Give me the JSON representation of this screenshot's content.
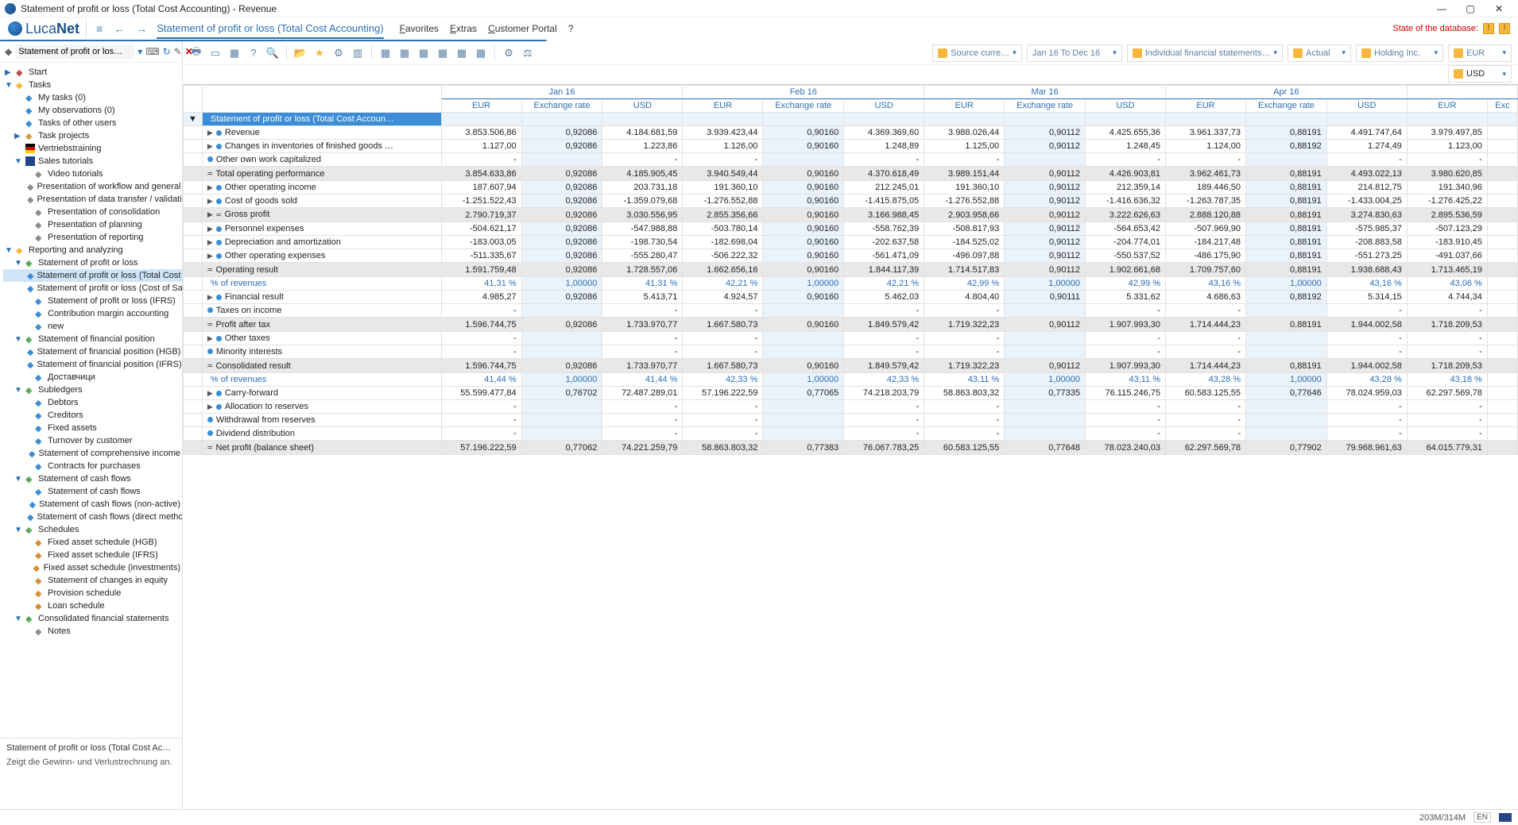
{
  "window": {
    "title": "Statement of profit or loss (Total Cost Accounting) - Revenue"
  },
  "brand": {
    "prefix": "Luca",
    "suffix": "Net"
  },
  "nav": {
    "breadcrumb": "Statement of profit or loss (Total Cost Accounting)"
  },
  "topmenu": {
    "fav": "Favorites",
    "ext": "Extras",
    "portal": "Customer Portal",
    "help": "?"
  },
  "state_db": {
    "label": "State of the database:"
  },
  "sidebar": {
    "search_placeholder": "Statement of profit or los…",
    "start": "Start",
    "tasks_h": "Tasks",
    "my_tasks": "My tasks (0)",
    "my_obs": "My observations (0)",
    "tasks_other": "Tasks of other users",
    "task_proj": "Task projects",
    "vertrieb": "Vertriebstraining",
    "sales": "Sales tutorials",
    "video": "Video tutorials",
    "pres_wf": "Presentation of workflow and general h…",
    "pres_dt": "Presentation of data transfer / validatio…",
    "pres_cons": "Presentation of consolidation",
    "pres_plan": "Presentation of planning",
    "pres_rep": "Presentation of reporting",
    "rep_h": "Reporting and analyzing",
    "spl": "Statement of profit or loss",
    "spl_tca": "Statement of profit or loss (Total Cost A…",
    "spl_cos": "Statement of profit or loss (Cost of Sales)",
    "spl_ifrs": "Statement of profit or loss (IFRS)",
    "cma": "Contribution margin accounting",
    "new": "new",
    "sfp": "Statement of financial position",
    "sfp_hgb": "Statement of financial position (HGB)",
    "sfp_ifrs": "Statement of financial position (IFRS)",
    "dost": "Доставчици",
    "subl": "Subledgers",
    "debtors": "Debtors",
    "creditors": "Creditors",
    "fa": "Fixed assets",
    "tbc": "Turnover by customer",
    "sci": "Statement of comprehensive income",
    "cfp": "Contracts for purchases",
    "scf": "Statement of cash flows",
    "scf1": "Statement of cash flows",
    "scf2": "Statement of cash flows (non-active)",
    "scf3": "Statement of cash flows (direct method)",
    "sched": "Schedules",
    "fas_hgb": "Fixed asset schedule (HGB)",
    "fas_ifrs": "Fixed asset schedule (IFRS)",
    "fas_inv": "Fixed asset schedule (investments)",
    "scie": "Statement of changes in equity",
    "prov": "Provision schedule",
    "loan": "Loan schedule",
    "cfs": "Consolidated financial statements",
    "notes": "Notes",
    "foot_title": "Statement of profit or loss (Total Cost Ac…",
    "foot_desc": "Zeigt die Gewinn- und Verlustrechnung an."
  },
  "filters": {
    "source": "Source curre…",
    "period": "Jan 16 To Dec 16",
    "ifs": "Individual financial statements…",
    "actual": "Actual",
    "entity": "Holding Inc.",
    "cur1": "EUR",
    "cur2": "USD"
  },
  "months": [
    "Jan 16",
    "Feb 16",
    "Mar 16",
    "Apr 16",
    ""
  ],
  "subcols": {
    "eur": "EUR",
    "rate": "Exchange rate",
    "usd": "USD",
    "exc": "Exc"
  },
  "rows": [
    {
      "k": "section",
      "lbl": "Statement of profit or loss (Total Cost Accoun…",
      "v": [
        "",
        "",
        "",
        "",
        "",
        "",
        "",
        "",
        "",
        "",
        "",
        "",
        "",
        ""
      ]
    },
    {
      "k": "d",
      "ic": "tb",
      "lbl": "Revenue",
      "v": [
        "3.853.506,86",
        "0,92086",
        "4.184.681,59",
        "3.939.423,44",
        "0,90160",
        "4.369.369,60",
        "3.988.026,44",
        "0,90112",
        "4.425.655,36",
        "3.961.337,73",
        "0,88191",
        "4.491.747,64",
        "3.979.497,85",
        ""
      ]
    },
    {
      "k": "d",
      "ic": "tb",
      "lbl": "Changes in inventories of finished goods …",
      "v": [
        "1.127,00",
        "0,92086",
        "1.223,86",
        "1.126,00",
        "0,90160",
        "1.248,89",
        "1.125,00",
        "0,90112",
        "1.248,45",
        "1.124,00",
        "0,88192",
        "1.274,49",
        "1.123,00",
        ""
      ]
    },
    {
      "k": "d",
      "ic": "b",
      "lbl": "Other own work capitalized",
      "v": [
        "-",
        "",
        "-",
        "-",
        "",
        "-",
        "-",
        "",
        "-",
        "-",
        "",
        "-",
        "-",
        ""
      ]
    },
    {
      "k": "subtotal",
      "ic": "eq",
      "lbl": "Total operating performance",
      "v": [
        "3.854.633,86",
        "0,92086",
        "4.185.905,45",
        "3.940.549,44",
        "0,90160",
        "4.370.618,49",
        "3.989.151,44",
        "0,90112",
        "4.426.903,81",
        "3.962.461,73",
        "0,88191",
        "4.493.022,13",
        "3.980.620,85",
        ""
      ]
    },
    {
      "k": "d",
      "ic": "tb",
      "lbl": "Other operating income",
      "v": [
        "187.607,94",
        "0,92086",
        "203.731,18",
        "191.360,10",
        "0,90160",
        "212.245,01",
        "191.360,10",
        "0,90112",
        "212.359,14",
        "189.446,50",
        "0,88191",
        "214.812,75",
        "191.340,96",
        ""
      ]
    },
    {
      "k": "d",
      "ic": "tb",
      "lbl": "Cost of goods sold",
      "v": [
        "-1.251.522,43",
        "0,92086",
        "-1.359.079,68",
        "-1.276.552,88",
        "0,90160",
        "-1.415.875,05",
        "-1.276.552,88",
        "0,90112",
        "-1.416.636,32",
        "-1.263.787,35",
        "0,88191",
        "-1.433.004,25",
        "-1.276.425,22",
        ""
      ]
    },
    {
      "k": "subtotal",
      "ic": "teq",
      "lbl": "Gross profit",
      "v": [
        "2.790.719,37",
        "0,92086",
        "3.030.556,95",
        "2.855.356,66",
        "0,90160",
        "3.166.988,45",
        "2.903.958,66",
        "0,90112",
        "3.222.626,63",
        "2.888.120,88",
        "0,88191",
        "3.274.830,63",
        "2.895.536,59",
        ""
      ]
    },
    {
      "k": "d",
      "ic": "tb",
      "lbl": "Personnel expenses",
      "v": [
        "-504.621,17",
        "0,92086",
        "-547.988,88",
        "-503.780,14",
        "0,90160",
        "-558.762,39",
        "-508.817,93",
        "0,90112",
        "-564.653,42",
        "-507.969,90",
        "0,88191",
        "-575.985,37",
        "-507.123,29",
        ""
      ]
    },
    {
      "k": "d",
      "ic": "tb",
      "lbl": "Depreciation and amortization",
      "v": [
        "-183.003,05",
        "0,92086",
        "-198.730,54",
        "-182.698,04",
        "0,90160",
        "-202.637,58",
        "-184.525,02",
        "0,90112",
        "-204.774,01",
        "-184.217,48",
        "0,88191",
        "-208.883,58",
        "-183.910,45",
        ""
      ]
    },
    {
      "k": "d",
      "ic": "tb",
      "lbl": "Other operating expenses",
      "v": [
        "-511.335,67",
        "0,92086",
        "-555.280,47",
        "-506.222,32",
        "0,90160",
        "-561.471,09",
        "-496.097,88",
        "0,90112",
        "-550.537,52",
        "-486.175,90",
        "0,88191",
        "-551.273,25",
        "-491.037,66",
        ""
      ]
    },
    {
      "k": "subtotal",
      "ic": "eq",
      "lbl": "Operating result",
      "v": [
        "1.591.759,48",
        "0,92086",
        "1.728.557,06",
        "1.662.656,16",
        "0,90160",
        "1.844.117,39",
        "1.714.517,83",
        "0,90112",
        "1.902.661,68",
        "1.709.757,60",
        "0,88191",
        "1.938.688,43",
        "1.713.465,19",
        ""
      ]
    },
    {
      "k": "pct",
      "lbl": "% of revenues",
      "v": [
        "41,31 %",
        "1,00000",
        "41,31 %",
        "42,21 %",
        "1,00000",
        "42,21 %",
        "42,99 %",
        "1,00000",
        "42,99 %",
        "43,16 %",
        "1,00000",
        "43,16 %",
        "43,06 %",
        ""
      ]
    },
    {
      "k": "d",
      "ic": "tb",
      "lbl": "Financial result",
      "v": [
        "4.985,27",
        "0,92086",
        "5.413,71",
        "4.924,57",
        "0,90160",
        "5.462,03",
        "4.804,40",
        "0,90111",
        "5.331,62",
        "4.686,63",
        "0,88192",
        "5.314,15",
        "4.744,34",
        ""
      ]
    },
    {
      "k": "d",
      "ic": "b",
      "lbl": "Taxes on income",
      "v": [
        "-",
        "",
        "-",
        "-",
        "",
        "-",
        "-",
        "",
        "-",
        "-",
        "",
        "-",
        "-",
        ""
      ]
    },
    {
      "k": "subtotal",
      "ic": "eq",
      "lbl": "Profit after tax",
      "v": [
        "1.596.744,75",
        "0,92086",
        "1.733.970,77",
        "1.667.580,73",
        "0,90160",
        "1.849.579,42",
        "1.719.322,23",
        "0,90112",
        "1.907.993,30",
        "1.714.444,23",
        "0,88191",
        "1.944.002,58",
        "1.718.209,53",
        ""
      ]
    },
    {
      "k": "d",
      "ic": "tb",
      "lbl": "Other taxes",
      "v": [
        "-",
        "",
        "-",
        "-",
        "",
        "-",
        "-",
        "",
        "-",
        "-",
        "",
        "-",
        "-",
        ""
      ]
    },
    {
      "k": "d",
      "ic": "b",
      "lbl": "Minority interests",
      "v": [
        "-",
        "",
        "-",
        "-",
        "",
        "-",
        "-",
        "",
        "-",
        "-",
        "",
        "-",
        "-",
        ""
      ]
    },
    {
      "k": "subtotal",
      "ic": "eq",
      "lbl": "Consolidated result",
      "v": [
        "1.596.744,75",
        "0,92086",
        "1.733.970,77",
        "1.667.580,73",
        "0,90160",
        "1.849.579,42",
        "1.719.322,23",
        "0,90112",
        "1.907.993,30",
        "1.714.444,23",
        "0,88191",
        "1.944.002,58",
        "1.718.209,53",
        ""
      ]
    },
    {
      "k": "pct",
      "lbl": "% of revenues",
      "v": [
        "41,44 %",
        "1,00000",
        "41,44 %",
        "42,33 %",
        "1,00000",
        "42,33 %",
        "43,11 %",
        "1,00000",
        "43,11 %",
        "43,28 %",
        "1,00000",
        "43,28 %",
        "43,18 %",
        ""
      ]
    },
    {
      "k": "d",
      "ic": "tb",
      "lbl": "Carry-forward",
      "v": [
        "55.599.477,84",
        "0,76702",
        "72.487.289,01",
        "57.196.222,59",
        "0,77065",
        "74.218.203,79",
        "58.863.803,32",
        "0,77335",
        "76.115.246,75",
        "60.583.125,55",
        "0,77646",
        "78.024.959,03",
        "62.297.569,78",
        ""
      ]
    },
    {
      "k": "d",
      "ic": "tb",
      "lbl": "Allocation to reserves",
      "v": [
        "-",
        "",
        "-",
        "-",
        "",
        "-",
        "-",
        "",
        "-",
        "-",
        "",
        "-",
        "-",
        ""
      ]
    },
    {
      "k": "d",
      "ic": "b",
      "lbl": "Withdrawal from reserves",
      "v": [
        "-",
        "",
        "-",
        "-",
        "",
        "-",
        "-",
        "",
        "-",
        "-",
        "",
        "-",
        "-",
        ""
      ]
    },
    {
      "k": "d",
      "ic": "b",
      "lbl": "Dividend distribution",
      "v": [
        "-",
        "",
        "-",
        "-",
        "",
        "-",
        "-",
        "",
        "-",
        "-",
        "",
        "-",
        "-",
        ""
      ]
    },
    {
      "k": "subtotal",
      "ic": "eq",
      "lbl": "Net profit (balance sheet)",
      "v": [
        "57.196.222,59",
        "0,77062",
        "74.221.259,79",
        "58.863.803,32",
        "0,77383",
        "76.067.783,25",
        "60.583.125,55",
        "0,77648",
        "78.023.240,03",
        "62.297.569,78",
        "0,77902",
        "79.968.961,63",
        "64.015.779,31",
        ""
      ]
    }
  ],
  "status": {
    "mem": "203M/314M",
    "lang": "EN"
  }
}
